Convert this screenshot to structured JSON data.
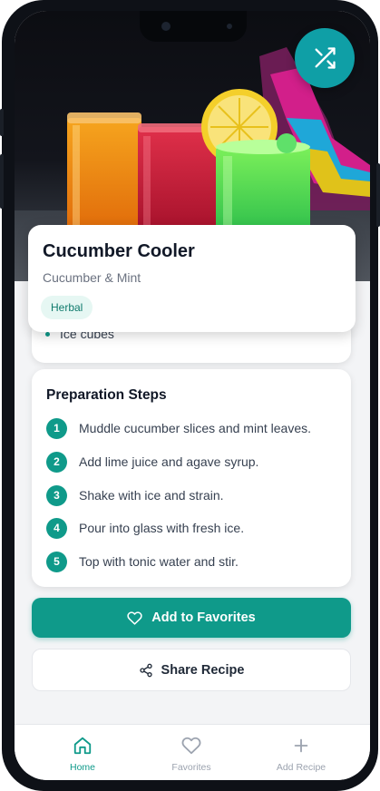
{
  "recipe": {
    "name": "Cucumber Cooler",
    "subtitle": "Cucumber & Mint",
    "tag": "Herbal"
  },
  "ingredients": {
    "visible_item": "Ice cubes"
  },
  "steps": {
    "heading": "Preparation Steps",
    "items": [
      {
        "num": "1",
        "text": "Muddle cucumber slices and mint leaves."
      },
      {
        "num": "2",
        "text": "Add lime juice and agave syrup."
      },
      {
        "num": "3",
        "text": "Shake with ice and strain."
      },
      {
        "num": "4",
        "text": "Pour into glass with fresh ice."
      },
      {
        "num": "5",
        "text": "Top with tonic water and stir."
      }
    ]
  },
  "actions": {
    "favorite_label": "Add to Favorites",
    "share_label": "Share Recipe"
  },
  "nav": {
    "home": "Home",
    "favorites": "Favorites",
    "add": "Add Recipe"
  },
  "icons": {
    "shuffle": "shuffle-icon",
    "heart": "heart-icon",
    "share": "share-icon",
    "home": "home-icon",
    "plus": "plus-icon"
  },
  "colors": {
    "accent": "#0f9a8a",
    "shuffle_button": "#0f9fa6",
    "tag_background": "#e6f7f3",
    "inactive_nav": "#9ca3af"
  }
}
